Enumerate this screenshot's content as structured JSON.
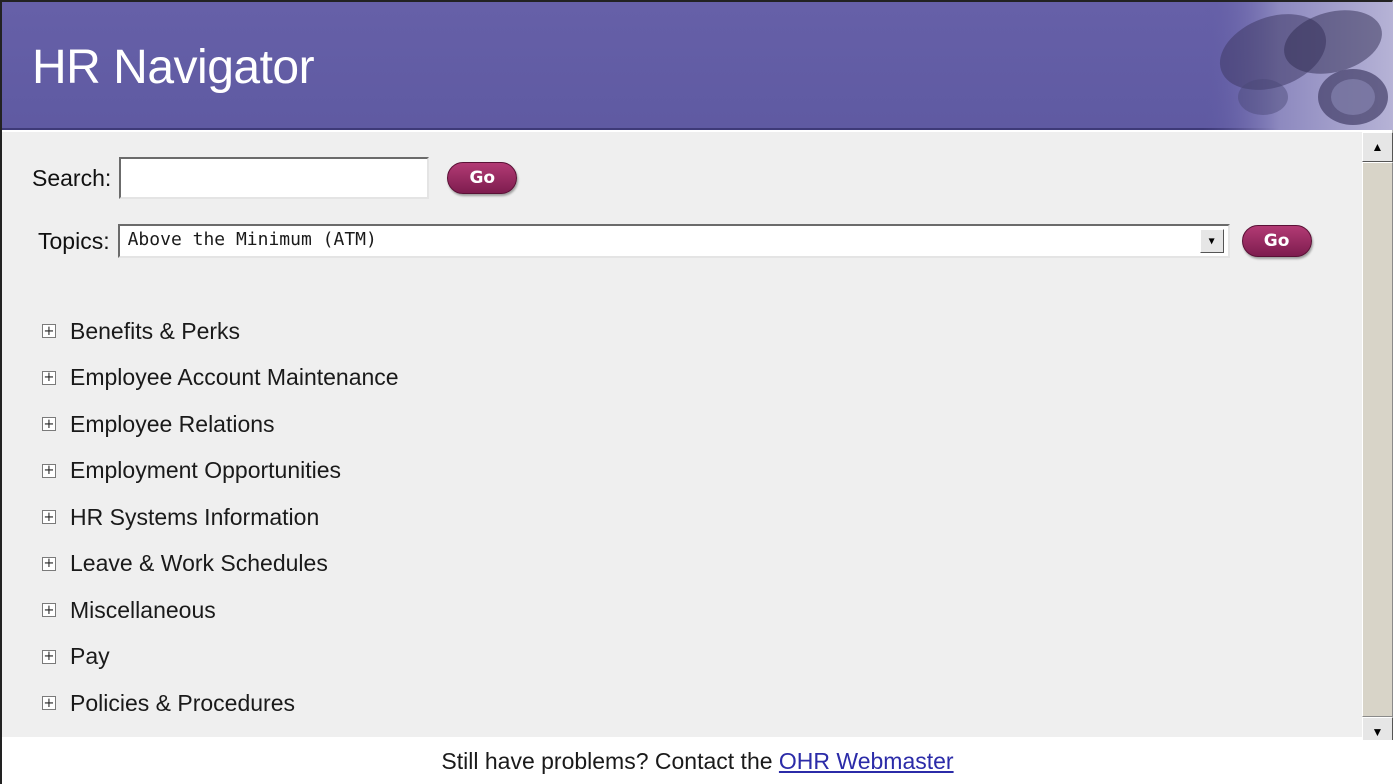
{
  "header": {
    "title": "HR Navigator",
    "image_icon": "binoculars-icon"
  },
  "search": {
    "label": "Search:",
    "value": "",
    "placeholder": "",
    "go_label": "Go"
  },
  "topics": {
    "label": "Topics:",
    "selected": "Above the Minimum (ATM)",
    "go_label": "Go"
  },
  "tree": {
    "expand_symbol": "+",
    "items": [
      {
        "label": "Benefits & Perks"
      },
      {
        "label": "Employee Account Maintenance"
      },
      {
        "label": "Employee Relations"
      },
      {
        "label": "Employment Opportunities"
      },
      {
        "label": "HR Systems Information"
      },
      {
        "label": "Leave & Work Schedules"
      },
      {
        "label": "Miscellaneous"
      },
      {
        "label": "Pay"
      },
      {
        "label": "Policies & Procedures"
      }
    ]
  },
  "footer": {
    "text": "Still have problems? Contact the ",
    "link_text": "OHR Webmaster"
  },
  "colors": {
    "header_bg": "#6660a8",
    "go_button": "#9a2a62",
    "link": "#2b2ba8",
    "panel_bg": "#efefef"
  }
}
